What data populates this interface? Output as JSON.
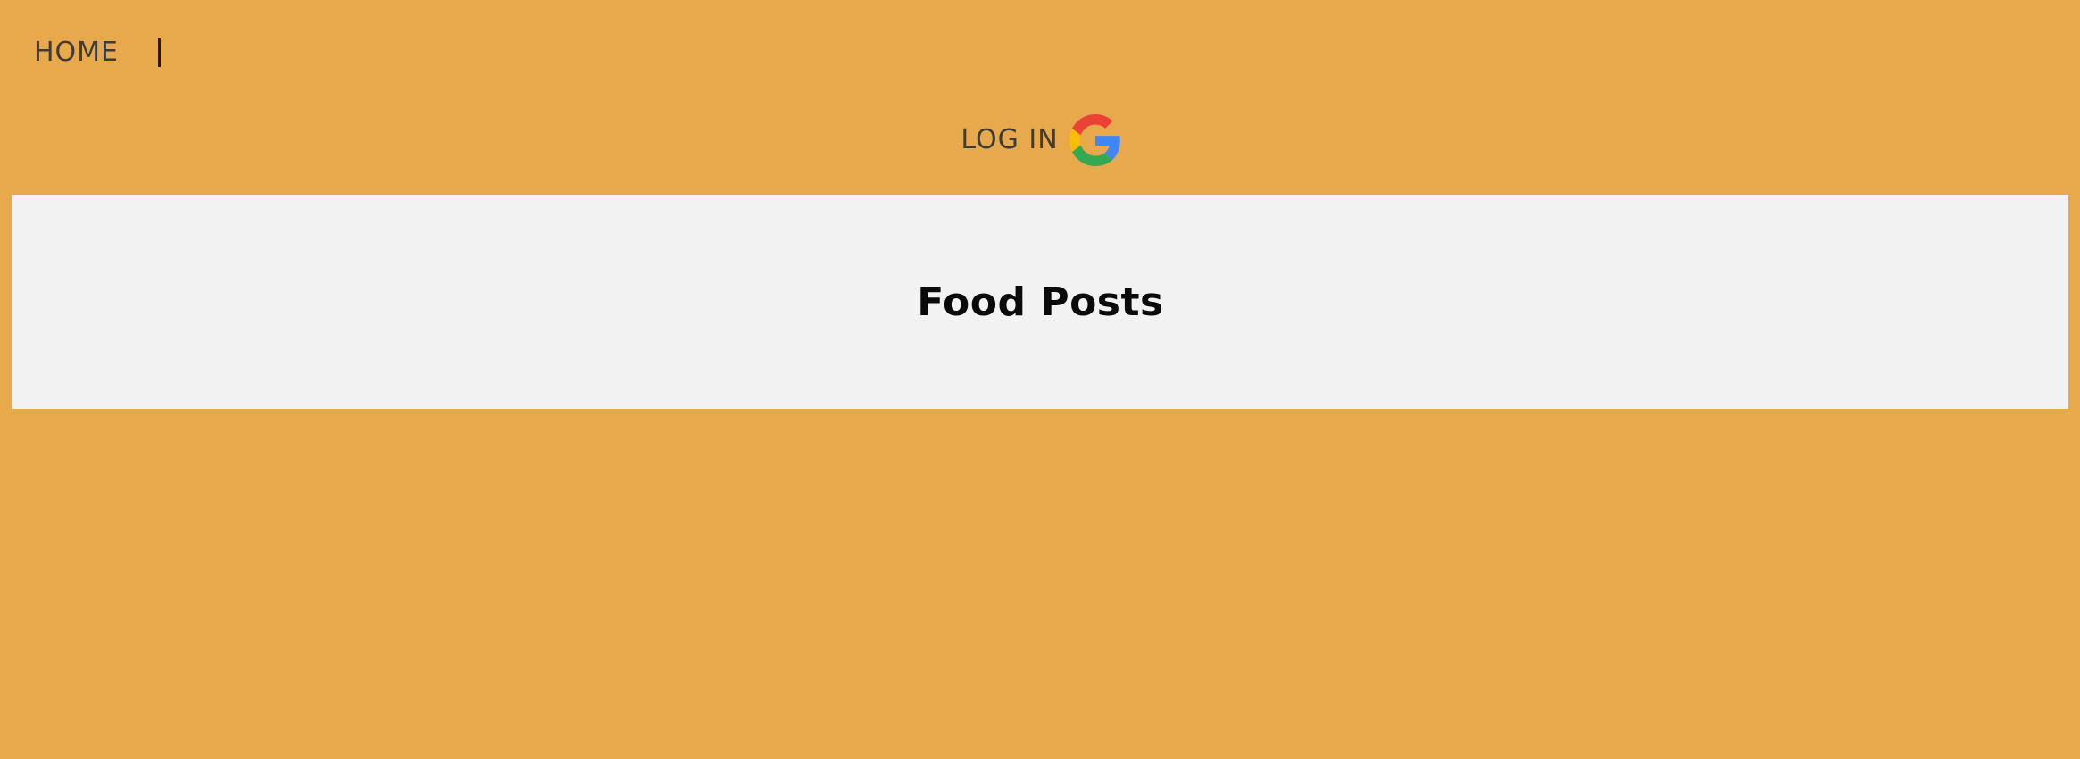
{
  "nav": {
    "home_label": "HOME"
  },
  "auth": {
    "login_label": "LOG IN",
    "provider_icon": "google-icon"
  },
  "banner": {
    "title": "Food Posts"
  },
  "colors": {
    "page_background": "#E8A94C",
    "banner_background": "#F2F2F2",
    "nav_text": "#3c3c3c",
    "title_text": "#0a0a0a"
  }
}
